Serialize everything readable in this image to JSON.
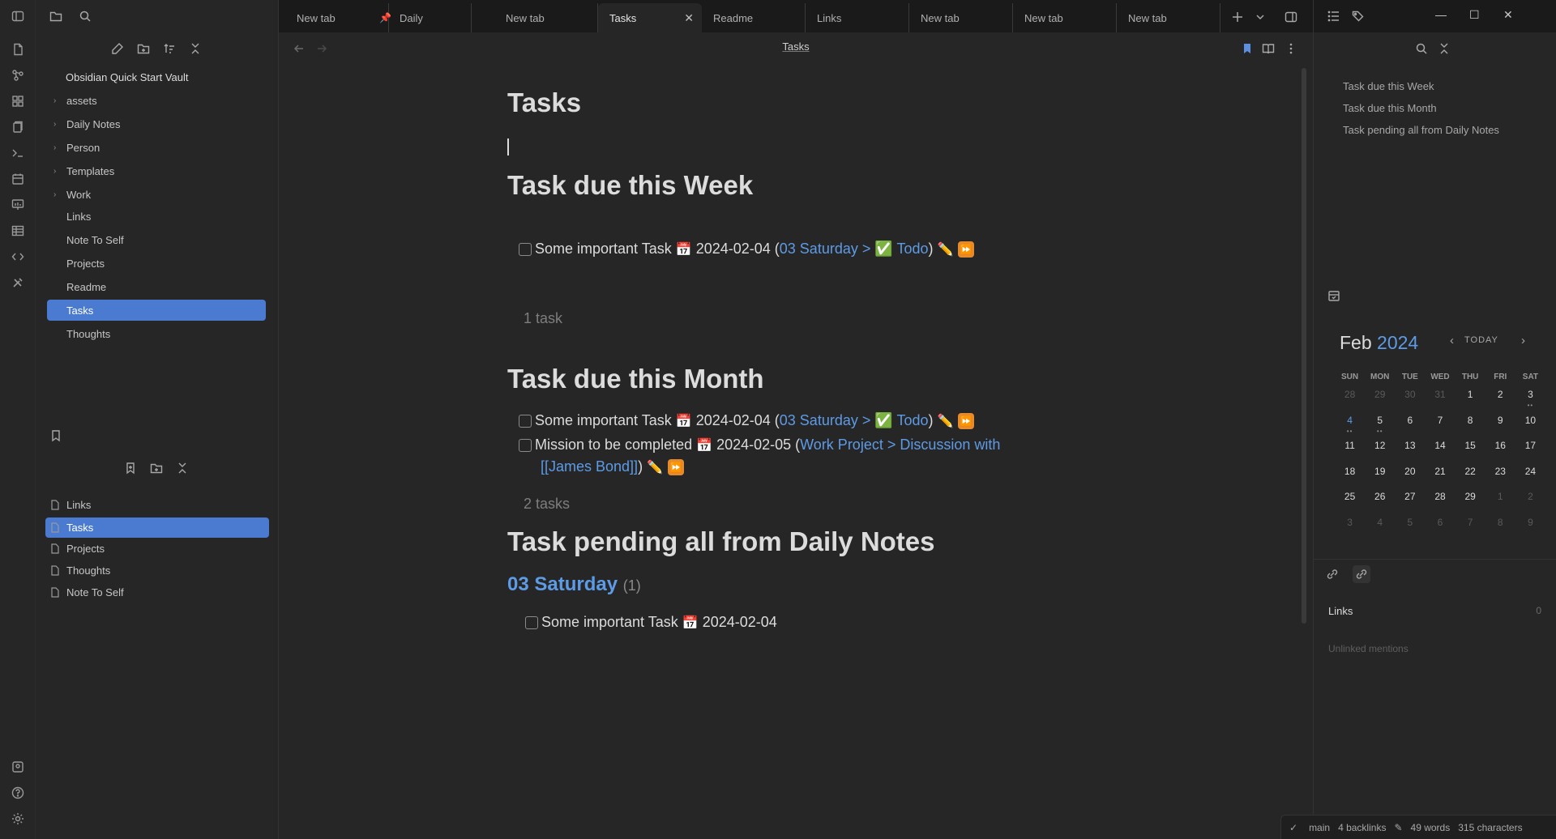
{
  "vault": {
    "name": "Obsidian Quick Start Vault"
  },
  "file_tree": [
    {
      "label": "assets",
      "folder": true
    },
    {
      "label": "Daily Notes",
      "folder": true
    },
    {
      "label": "Person",
      "folder": true
    },
    {
      "label": "Templates",
      "folder": true
    },
    {
      "label": "Work",
      "folder": true
    },
    {
      "label": "Links",
      "folder": false
    },
    {
      "label": "Note To Self",
      "folder": false
    },
    {
      "label": "Projects",
      "folder": false
    },
    {
      "label": "Readme",
      "folder": false
    },
    {
      "label": "Tasks",
      "folder": false,
      "active": true
    },
    {
      "label": "Thoughts",
      "folder": false
    }
  ],
  "bookmarks": [
    {
      "label": "Links"
    },
    {
      "label": "Tasks",
      "active": true
    },
    {
      "label": "Projects"
    },
    {
      "label": "Thoughts"
    },
    {
      "label": "Note To Self"
    }
  ],
  "tabs": [
    {
      "label": "New tab"
    },
    {
      "label": "Daily",
      "pinned": true
    },
    {
      "label": "New tab"
    },
    {
      "label": "Tasks",
      "active": true
    },
    {
      "label": "Readme"
    },
    {
      "label": "Links"
    },
    {
      "label": "New tab"
    },
    {
      "label": "New tab"
    },
    {
      "label": "New tab"
    }
  ],
  "view": {
    "title": "Tasks"
  },
  "document": {
    "title": "Tasks",
    "sections": {
      "week": {
        "heading": "Task due this Week",
        "count": "1 task"
      },
      "month": {
        "heading": "Task due this Month",
        "count": "2 tasks"
      },
      "pending": {
        "heading": "Task pending all from Daily Notes",
        "group": "03 Saturday",
        "group_count": "(1)"
      }
    },
    "tasks": {
      "t1": {
        "text": "Some important Task",
        "date": "2024-02-04",
        "link": "03 Saturday > ✅ Todo"
      },
      "t2": {
        "text": "Some important Task",
        "date": "2024-02-04",
        "link": "03 Saturday > ✅ Todo"
      },
      "t3": {
        "text": "Mission to be completed",
        "date": "2024-02-05",
        "link1": "Work Project > Discussion with",
        "link2": "[[James Bond]]"
      },
      "t4": {
        "text": "Some important Task",
        "date": "2024-02-04"
      }
    }
  },
  "outline": [
    "Task due this Week",
    "Task due this Month",
    "Task pending all from Daily Notes"
  ],
  "calendar": {
    "month": "Feb",
    "year": "2024",
    "today_label": "TODAY",
    "weekdays": [
      "SUN",
      "MON",
      "TUE",
      "WED",
      "THU",
      "FRI",
      "SAT"
    ],
    "weeks": [
      [
        "28",
        "29",
        "30",
        "31",
        "1",
        "2",
        "3"
      ],
      [
        "4",
        "5",
        "6",
        "7",
        "8",
        "9",
        "10"
      ],
      [
        "11",
        "12",
        "13",
        "14",
        "15",
        "16",
        "17"
      ],
      [
        "18",
        "19",
        "20",
        "21",
        "22",
        "23",
        "24"
      ],
      [
        "25",
        "26",
        "27",
        "28",
        "29",
        "1",
        "2"
      ],
      [
        "3",
        "4",
        "5",
        "6",
        "7",
        "8",
        "9"
      ]
    ]
  },
  "backlinks": {
    "title": "Links",
    "count": "0",
    "unlinked": "Unlinked mentions"
  },
  "status": {
    "branch": "main",
    "backlinks": "4 backlinks",
    "words": "49 words",
    "characters": "315 characters"
  }
}
